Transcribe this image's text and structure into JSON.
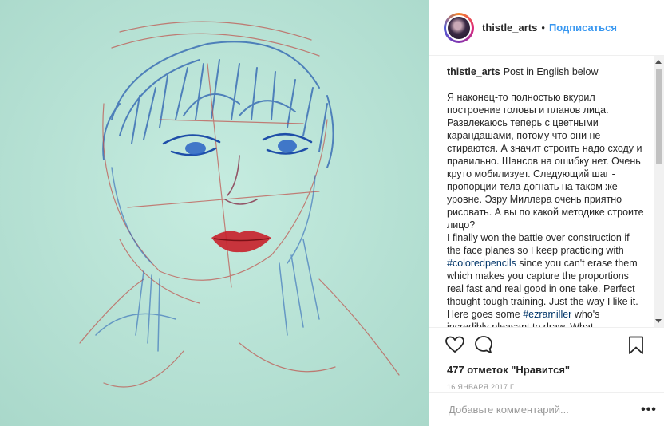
{
  "post": {
    "image_alt": "Colored pencil portrait sketch",
    "header": {
      "username": "thistle_arts",
      "separator": "•",
      "follow_label": "Подписаться"
    },
    "caption": {
      "username": "thistle_arts",
      "first_line": "Post in English below",
      "russian_text": "Я наконец-то полностью вкурил построение головы и планов лица. Развлекаюсь теперь с цветными карандашами, потому что они не стираются. А значит строить надо сходу и правильно. Шансов на ошибку нет. Очень круто мобилизует. Следующий шаг - пропорции тела догнать на таком же уровне. Эзру Миллера очень приятно рисовать. А вы по какой методике строите лицо?",
      "english_part1": "I finally won the battle over construction if the face planes so I keep practicing with",
      "hashtag1": "#coloredpencils",
      "english_part2": "since you can't erase them which makes you capture the proportions real fast and real good in one take. Perfect thought tough training. Just the way I like it. Here goes some",
      "hashtag2": "#ezramiller",
      "english_part3": "who's incredibly pleasant to draw. What"
    },
    "likes_text": "477 отметок \"Нравится\"",
    "date_text": "16 ЯНВАРЯ 2017 Г.",
    "comment_placeholder": "Добавьте комментарий...",
    "more_label": "•••"
  },
  "icons": {
    "like": "heart-outline",
    "comment": "speech-bubble",
    "save": "bookmark"
  },
  "colors": {
    "link_blue": "#3897f0",
    "hashtag": "#003569",
    "paper_mint": "#bfe6da",
    "lips_red": "#c8202a"
  }
}
